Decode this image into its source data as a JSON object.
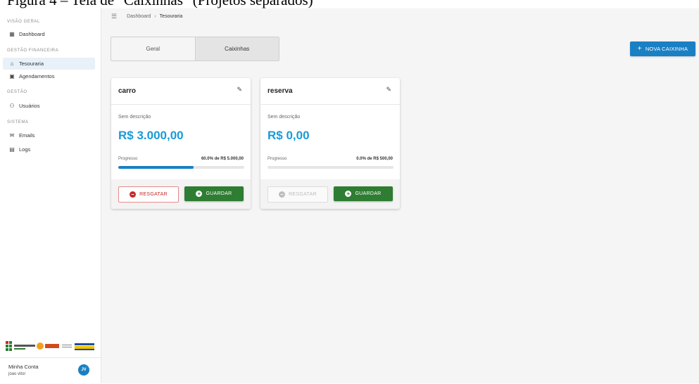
{
  "caption": {
    "prefix": "Figura 4 – ",
    "text": "Tela de \"Caixinhas\" (Projetos separados)"
  },
  "sidebar": {
    "sections": [
      {
        "title": "VISÃO GERAL",
        "items": [
          {
            "label": "Dashboard",
            "icon": "dashboard-icon"
          }
        ]
      },
      {
        "title": "GESTÃO FINANCEIRA",
        "items": [
          {
            "label": "Tesouraria",
            "icon": "bank-icon",
            "active": true
          },
          {
            "label": "Agendamentos",
            "icon": "calendar-icon"
          }
        ]
      },
      {
        "title": "GESTÃO",
        "items": [
          {
            "label": "Usuários",
            "icon": "users-icon"
          }
        ]
      },
      {
        "title": "SISTEMA",
        "items": [
          {
            "label": "Emails",
            "icon": "mail-icon"
          },
          {
            "label": "Logs",
            "icon": "document-icon"
          }
        ]
      }
    ],
    "logos": {
      "if": "INSTITUTO FEDERAL",
      "fapeg": "FAPEG"
    },
    "account": {
      "label": "Minha Conta",
      "user": "joao vitor",
      "initials": "JV"
    }
  },
  "header": {
    "breadcrumb_root": "Dashboard",
    "breadcrumb_sep": "›",
    "breadcrumb_current": "Tesouraria"
  },
  "tabs": [
    {
      "label": "Geral",
      "active": false
    },
    {
      "label": "Caixinhas",
      "active": true
    }
  ],
  "new_button": {
    "label": "NOVA CAIXINHA",
    "icon": "+"
  },
  "colors": {
    "primary": "#1a80c4",
    "amount": "#1a9ad6",
    "success": "#2e7d32",
    "danger": "#c62828"
  },
  "cards": [
    {
      "title": "carro",
      "description": "Sem descrição",
      "amount": "R$ 3.000,00",
      "progress_label": "Progresso",
      "progress_text": "60.0% de R$ 5.000,00",
      "progress": 0.6,
      "withdraw_label": "RESGATAR",
      "withdraw_enabled": true,
      "save_label": "GUARDAR"
    },
    {
      "title": "reserva",
      "description": "Sem descrição",
      "amount": "R$ 0,00",
      "progress_label": "Progresso",
      "progress_text": "0.0% de R$ 500,00",
      "progress": 0.0,
      "withdraw_label": "RESGATAR",
      "withdraw_enabled": false,
      "save_label": "GUARDAR"
    }
  ]
}
